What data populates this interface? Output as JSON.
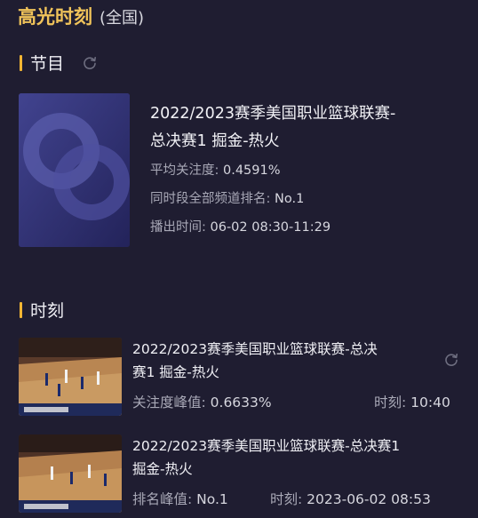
{
  "header": {
    "title": "高光时刻",
    "scope": "(全国)"
  },
  "program_section": {
    "label": "节目",
    "refresh_icon": "refresh-icon"
  },
  "program": {
    "name_line1": "2022/2023赛季美国职业篮球联赛-",
    "name_line2": "总决赛1 掘金-热火",
    "avg_attention_label": "平均关注度: ",
    "avg_attention_value": "0.4591%",
    "rank_label": "同时段全部频道排名: ",
    "rank_value": "No.1",
    "air_time_label": "播出时间: ",
    "air_time_value": "06-02 08:30-11:29"
  },
  "moments_section": {
    "label": "时刻"
  },
  "moments": [
    {
      "name_line1": "2022/2023赛季美国职业篮球联赛-总决",
      "name_line2": "赛1 掘金-热火",
      "peak_label": "关注度峰值: ",
      "peak_value": "0.6633%",
      "time_label": "时刻: ",
      "time_value": "10:40"
    },
    {
      "name_line1": "2022/2023赛季美国职业篮球联赛-总决赛1",
      "name_line2": "掘金-热火",
      "peak_label": "排名峰值: ",
      "peak_value": "No.1",
      "time_label": "时刻: ",
      "time_value": "2023-06-02 08:53"
    }
  ],
  "colors": {
    "background": "#1f1d31",
    "accent_gold": "#f0c35a",
    "section_bar": "#f2b533",
    "muted_text": "#a8a8b6"
  }
}
